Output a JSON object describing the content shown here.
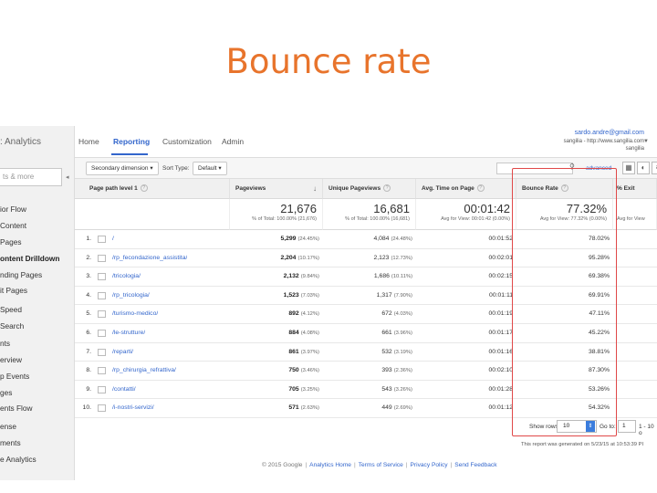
{
  "slide_title": "Bounce rate",
  "brand_fragment": ": Analytics",
  "sidebar": {
    "search_placeholder": "ts & more",
    "collapse_glyph": "◂",
    "items": [
      {
        "label": "ior Flow",
        "bold": false
      },
      {
        "label": "Content",
        "bold": false
      },
      {
        "label": "Pages",
        "bold": false
      },
      {
        "label": "ontent Drilldown",
        "bold": true
      },
      {
        "label": "nding Pages",
        "bold": false
      },
      {
        "label": "it Pages",
        "bold": false
      },
      {
        "label": "Speed",
        "bold": false
      },
      {
        "label": "Search",
        "bold": false
      },
      {
        "label": "nts",
        "bold": false
      },
      {
        "label": "erview",
        "bold": false
      },
      {
        "label": "p Events",
        "bold": false
      },
      {
        "label": "ges",
        "bold": false
      },
      {
        "label": "ents Flow",
        "bold": false
      },
      {
        "label": "ense",
        "bold": false
      },
      {
        "label": "ments",
        "bold": false
      },
      {
        "label": "e Analytics",
        "bold": false
      }
    ]
  },
  "nav": {
    "tabs": [
      "Home",
      "Reporting",
      "Customization",
      "Admin"
    ],
    "active": "Reporting"
  },
  "account": {
    "email": "sardo.andre@gmail.com",
    "property": "sangilia - http://www.sangilia.com",
    "view": "sangilia",
    "caret": "▼"
  },
  "toolbar": {
    "secondary_dimension": "Secondary dimension",
    "sort_type_label": "Sort Type:",
    "sort_type_value": "Default",
    "dropdown_glyph": "▾",
    "search_glyph": "⚲",
    "advanced": "advanced",
    "view_glyphs": [
      "▦",
      "◐",
      "≡"
    ]
  },
  "table": {
    "headers": [
      "Page path level 1",
      "Pageviews",
      "Unique Pageviews",
      "Avg. Time on Page",
      "Bounce Rate",
      "% Exit"
    ],
    "help_glyph": "?",
    "sort_glyph": "↓",
    "totals": {
      "pageviews": "21,676",
      "pageviews_sub": "% of Total: 100.00% (21,676)",
      "unique": "16,681",
      "unique_sub": "% of Total: 100.00% (16,681)",
      "time": "00:01:42",
      "time_sub": "Avg for View: 00:01:42 (0.00%)",
      "bounce": "77.32%",
      "bounce_sub": "Avg for View: 77.32% (0.00%)",
      "exit_sub": "Avg for View"
    },
    "rows": [
      {
        "num": "1.",
        "path": "/",
        "pv": "5,299",
        "pv_pct": "(24.45%)",
        "upv": "4,084",
        "upv_pct": "(24.48%)",
        "time": "00:01:52",
        "bounce": "78.02%"
      },
      {
        "num": "2.",
        "path": "/rp_fecondazione_assistita/",
        "pv": "2,204",
        "pv_pct": "(10.17%)",
        "upv": "2,123",
        "upv_pct": "(12.73%)",
        "time": "00:02:01",
        "bounce": "95.28%"
      },
      {
        "num": "3.",
        "path": "/tricologia/",
        "pv": "2,132",
        "pv_pct": "(9.84%)",
        "upv": "1,686",
        "upv_pct": "(10.11%)",
        "time": "00:02:15",
        "bounce": "69.38%"
      },
      {
        "num": "4.",
        "path": "/rp_tricologia/",
        "pv": "1,523",
        "pv_pct": "(7.03%)",
        "upv": "1,317",
        "upv_pct": "(7.90%)",
        "time": "00:01:11",
        "bounce": "69.91%"
      },
      {
        "num": "5.",
        "path": "/turismo-medico/",
        "pv": "892",
        "pv_pct": "(4.12%)",
        "upv": "672",
        "upv_pct": "(4.03%)",
        "time": "00:01:19",
        "bounce": "47.11%"
      },
      {
        "num": "6.",
        "path": "/le-strutture/",
        "pv": "884",
        "pv_pct": "(4.08%)",
        "upv": "661",
        "upv_pct": "(3.96%)",
        "time": "00:01:17",
        "bounce": "45.22%"
      },
      {
        "num": "7.",
        "path": "/reparti/",
        "pv": "861",
        "pv_pct": "(3.97%)",
        "upv": "532",
        "upv_pct": "(3.19%)",
        "time": "00:01:16",
        "bounce": "38.81%"
      },
      {
        "num": "8.",
        "path": "/rp_chirurgia_refrattiva/",
        "pv": "750",
        "pv_pct": "(3.46%)",
        "upv": "393",
        "upv_pct": "(2.36%)",
        "time": "00:02:10",
        "bounce": "87.30%"
      },
      {
        "num": "9.",
        "path": "/contatti/",
        "pv": "705",
        "pv_pct": "(3.25%)",
        "upv": "543",
        "upv_pct": "(3.26%)",
        "time": "00:01:28",
        "bounce": "53.26%"
      },
      {
        "num": "10.",
        "path": "/i-nostri-servizi/",
        "pv": "571",
        "pv_pct": "(2.63%)",
        "upv": "449",
        "upv_pct": "(2.69%)",
        "time": "00:01:12",
        "bounce": "54.32%"
      }
    ]
  },
  "pagination": {
    "show_rows_label": "Show rows:",
    "show_rows_value": "10",
    "spin_glyph": "⇕",
    "goto_label": "Go to:",
    "goto_value": "1",
    "range": "1 - 10 o"
  },
  "generated_note": "This report was generated on 5/23/15 at 10:53:39 PI",
  "footer": {
    "copyright": "© 2015 Google",
    "links": [
      "Analytics Home",
      "Terms of Service",
      "Privacy Policy",
      "Send Feedback"
    ],
    "separator": "|"
  },
  "colors": {
    "title": "#e8742c",
    "link": "#3366cc",
    "highlight": "#e04848"
  }
}
